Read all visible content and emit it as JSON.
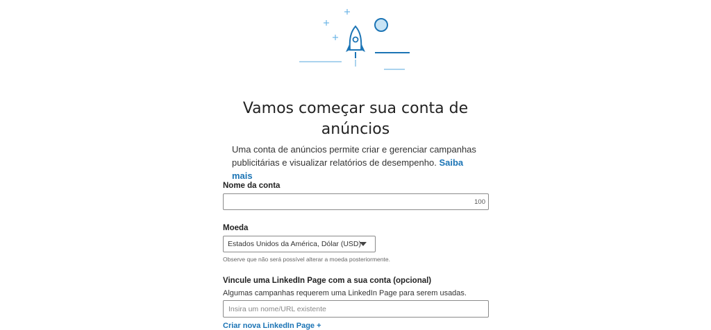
{
  "header": {
    "title": "Vamos começar sua conta de anúncios",
    "description": "Uma conta de anúncios permite criar e gerenciar campanhas publicitárias e visualizar relatórios de desempenho.",
    "learn_more": "Saiba mais"
  },
  "account_name": {
    "label": "Nome da conta",
    "value": "",
    "char_counter": "100"
  },
  "currency": {
    "label": "Moeda",
    "selected": "Estados Unidos da América, Dólar (USD)",
    "note": "Observe que não será possível alterar a moeda posteriormente."
  },
  "linkedin_page": {
    "label": "Vincule uma LinkedIn Page com a sua conta (opcional)",
    "help": "Algumas campanhas requerem uma LinkedIn Page para serem usadas.",
    "placeholder": "Insira um nome/URL existente",
    "create_link": "Criar nova LinkedIn Page +"
  },
  "colors": {
    "accent": "#1b74b5",
    "illustration": "#1b74b5",
    "illustration_light": "#aad3ee"
  },
  "icons": {
    "hero": "rocket-icon",
    "dropdown": "caret-down-icon"
  }
}
